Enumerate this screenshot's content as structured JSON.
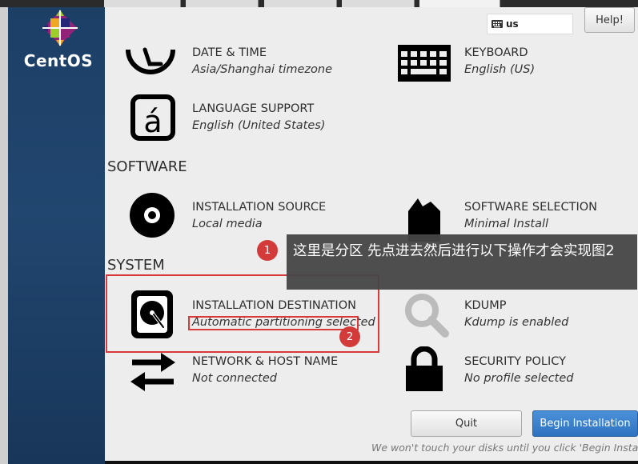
{
  "brand": {
    "name": "CentOS"
  },
  "header": {
    "keyboard_layout": "us",
    "help_label": "Help!"
  },
  "sections": {
    "software": "SOFTWARE",
    "system": "SYSTEM"
  },
  "spokes": {
    "date_time": {
      "title": "DATE & TIME",
      "status": "Asia/Shanghai timezone"
    },
    "keyboard": {
      "title": "KEYBOARD",
      "status": "English (US)"
    },
    "language": {
      "title": "LANGUAGE SUPPORT",
      "status": "English (United States)"
    },
    "source": {
      "title": "INSTALLATION SOURCE",
      "status": "Local media"
    },
    "software": {
      "title": "SOFTWARE SELECTION",
      "status": "Minimal Install"
    },
    "destination": {
      "title": "INSTALLATION DESTINATION",
      "status": "Automatic partitioning selected"
    },
    "kdump": {
      "title": "KDUMP",
      "status": "Kdump is enabled"
    },
    "network": {
      "title": "NETWORK & HOST NAME",
      "status": "Not connected"
    },
    "security": {
      "title": "SECURITY POLICY",
      "status": "No profile selected"
    }
  },
  "annotation": {
    "tooltip_text": "这里是分区 先点进去然后进行以下操作才会实现图2",
    "badge1": "1",
    "badge2": "2",
    "accent_color": "#d33a3a"
  },
  "footer": {
    "quit_label": "Quit",
    "begin_label": "Begin Installation",
    "note": "We won't touch your disks until you click 'Begin Installatio"
  },
  "colors": {
    "sidebar": "#21466f",
    "primary_button": "#3b82cc"
  }
}
